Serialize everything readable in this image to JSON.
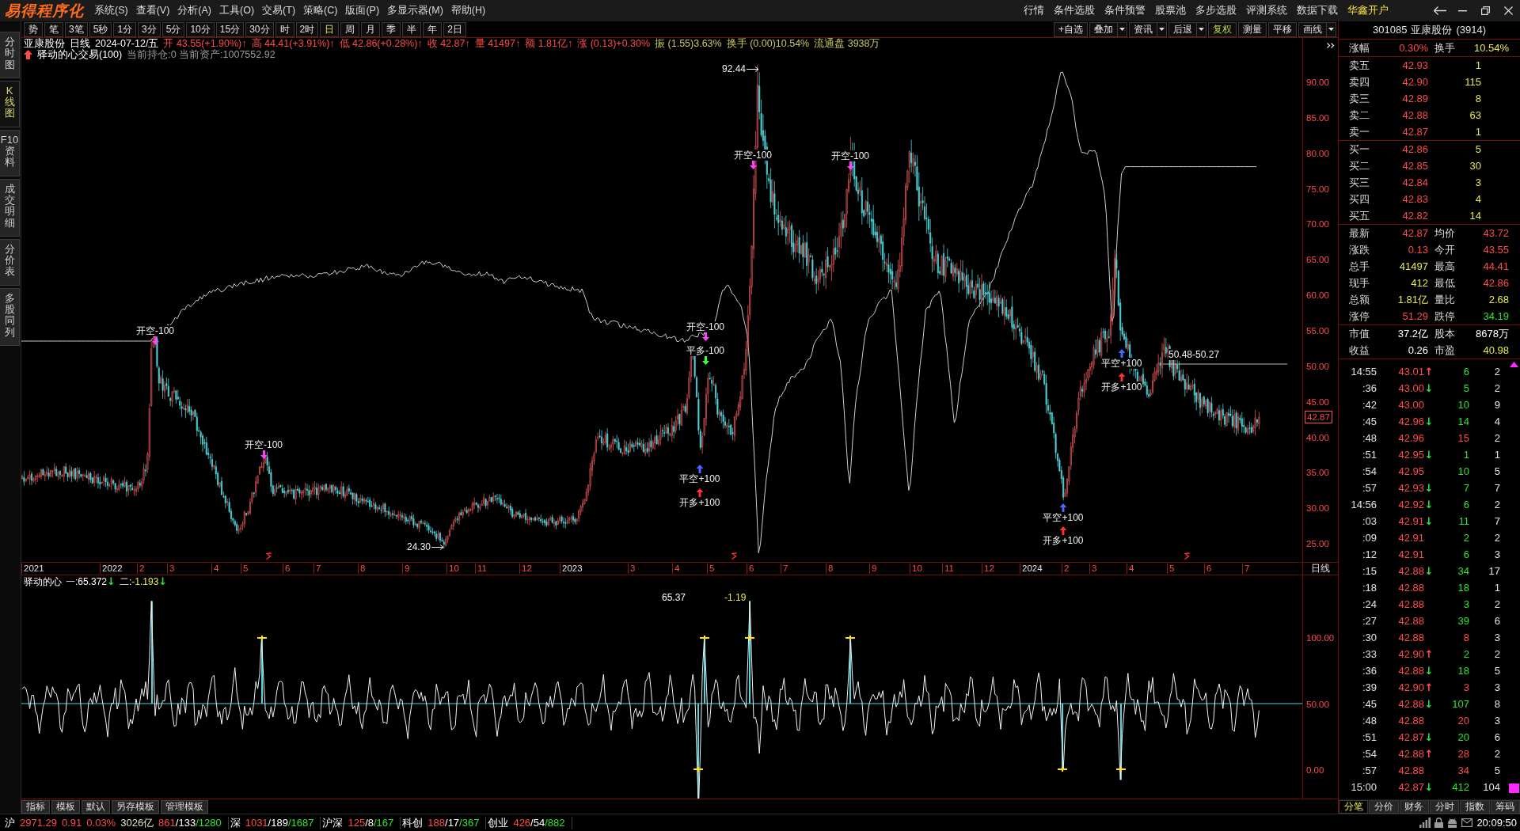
{
  "title_bar": {
    "logo": "易得程序化",
    "menu": [
      "系统(S)",
      "查看(V)",
      "分析(A)",
      "工具(O)",
      "交易(T)",
      "策略(C)",
      "版面(P)",
      "多显示器(M)",
      "帮助(H)"
    ],
    "links": [
      {
        "label": "行情",
        "highlight": false
      },
      {
        "label": "条件选股",
        "highlight": false
      },
      {
        "label": "条件预警",
        "highlight": false
      },
      {
        "label": "股票池",
        "highlight": false
      },
      {
        "label": "多步选股",
        "highlight": false
      },
      {
        "label": "评测系统",
        "highlight": false
      },
      {
        "label": "数据下载",
        "highlight": false
      },
      {
        "label": "华鑫开户",
        "highlight": true
      }
    ]
  },
  "side_tabs": [
    {
      "label": "分时图",
      "selected": false
    },
    {
      "label": "K线图",
      "selected": true
    },
    {
      "label": "F10资料",
      "selected": false
    },
    {
      "label": "成交明细",
      "selected": false
    },
    {
      "label": "分价表",
      "selected": false
    },
    {
      "label": "多股同列",
      "selected": false
    }
  ],
  "toolbar": {
    "periods": [
      {
        "label": "势",
        "selected": false
      },
      {
        "label": "笔",
        "selected": false
      },
      {
        "label": "3笔",
        "selected": false
      },
      {
        "label": "5秒",
        "selected": false
      },
      {
        "label": "1分",
        "selected": false
      },
      {
        "label": "3分",
        "selected": false
      },
      {
        "label": "5分",
        "selected": false
      },
      {
        "label": "10分",
        "selected": false
      },
      {
        "label": "15分",
        "selected": false
      },
      {
        "label": "30分",
        "selected": false
      },
      {
        "label": "时",
        "selected": false
      },
      {
        "label": "2时",
        "selected": false
      },
      {
        "label": "日",
        "selected": true
      },
      {
        "label": "周",
        "selected": false
      },
      {
        "label": "月",
        "selected": false
      },
      {
        "label": "季",
        "selected": false
      },
      {
        "label": "半",
        "selected": false
      },
      {
        "label": "年",
        "selected": false
      },
      {
        "label": "2日",
        "selected": false
      }
    ],
    "tools": [
      {
        "label": "+自选",
        "menu": false,
        "on": false
      },
      {
        "label": "叠加",
        "menu": true,
        "on": false
      },
      {
        "label": "资讯",
        "menu": true,
        "on": false
      },
      {
        "label": "后退",
        "menu": true,
        "on": false
      },
      {
        "label": "复权",
        "menu": false,
        "on": true
      },
      {
        "label": "测量",
        "menu": false,
        "on": false
      },
      {
        "label": "平移",
        "menu": false,
        "on": false
      },
      {
        "label": "画线",
        "menu": true,
        "on": false
      }
    ]
  },
  "chart": {
    "quote_line": [
      {
        "text": "亚康股份",
        "color": "#ffffff"
      },
      {
        "text": "日线",
        "color": "#ffffff"
      },
      {
        "text": "2024-07-12/五",
        "color": "#ffffff"
      },
      {
        "text": "开 43.55(+1.90%)↑",
        "color": "#ff4a4a"
      },
      {
        "text": "高 44.41(+3.91%)↑",
        "color": "#ff4a4a"
      },
      {
        "text": "低 42.86(+0.28%)↑",
        "color": "#ff4a4a"
      },
      {
        "text": "收 42.87↑",
        "color": "#ff4a4a"
      },
      {
        "text": "量 41497↑",
        "color": "#ff4a4a"
      },
      {
        "text": "额 1.81亿↑",
        "color": "#ff4a4a"
      },
      {
        "text": "涨 (0.13)+0.30%",
        "color": "#ff4a4a"
      },
      {
        "text": "振 (1.55)3.63%",
        "color": "#c8c864"
      },
      {
        "text": "换手 (0.00)10.54%",
        "color": "#c8c864"
      },
      {
        "text": "流通盘 3938万",
        "color": "#c8c864"
      }
    ],
    "strategy": {
      "name": "驿动的心交易(100)",
      "status": "当前持仓:0 当前资产:1007552.92"
    },
    "price_axis": [
      "90.00",
      "85.00",
      "80.00",
      "75.00",
      "70.00",
      "65.00",
      "60.00",
      "55.00",
      "50.00",
      "45.00",
      "40.00",
      "35.00",
      "30.00",
      "25.00"
    ],
    "last_price": "42.87",
    "extremes": [
      "92.44",
      "24.30"
    ],
    "range_label": "50.48-50.27",
    "signals": [
      {
        "label": "开空-100",
        "kind": "open_short"
      },
      {
        "label": "开空-100",
        "kind": "open_short"
      },
      {
        "label": "开空-100",
        "kind": "open_short"
      },
      {
        "label": "平多-100",
        "kind": "close_long"
      },
      {
        "label": "平空+100",
        "kind": "close_short"
      },
      {
        "label": "开多+100",
        "kind": "open_long"
      },
      {
        "label": "开空-100",
        "kind": "open_short"
      },
      {
        "label": "开空-100",
        "kind": "open_short"
      },
      {
        "label": "平空+100",
        "kind": "close_short"
      },
      {
        "label": "开多+100",
        "kind": "open_long"
      },
      {
        "label": "平空+100",
        "kind": "close_short"
      },
      {
        "label": "开多+100",
        "kind": "open_long"
      }
    ],
    "time_axis": [
      {
        "label": "2021",
        "kind": "year"
      },
      {
        "label": "2022",
        "kind": "year"
      },
      {
        "label": "2",
        "kind": "month"
      },
      {
        "label": "3",
        "kind": "month"
      },
      {
        "label": "4",
        "kind": "month"
      },
      {
        "label": "5",
        "kind": "month"
      },
      {
        "label": "6",
        "kind": "month"
      },
      {
        "label": "7",
        "kind": "month"
      },
      {
        "label": "8",
        "kind": "month"
      },
      {
        "label": "9",
        "kind": "month"
      },
      {
        "label": "10",
        "kind": "month"
      },
      {
        "label": "11",
        "kind": "month"
      },
      {
        "label": "12",
        "kind": "month"
      },
      {
        "label": "2023",
        "kind": "year"
      },
      {
        "label": "3",
        "kind": "month"
      },
      {
        "label": "4",
        "kind": "month"
      },
      {
        "label": "5",
        "kind": "month"
      },
      {
        "label": "6",
        "kind": "month"
      },
      {
        "label": "7",
        "kind": "month"
      },
      {
        "label": "8",
        "kind": "month"
      },
      {
        "label": "9",
        "kind": "month"
      },
      {
        "label": "10",
        "kind": "month"
      },
      {
        "label": "11",
        "kind": "month"
      },
      {
        "label": "12",
        "kind": "month"
      },
      {
        "label": "2024",
        "kind": "year"
      },
      {
        "label": "2",
        "kind": "month"
      },
      {
        "label": "3",
        "kind": "month"
      },
      {
        "label": "4",
        "kind": "month"
      },
      {
        "label": "5",
        "kind": "month"
      },
      {
        "label": "6",
        "kind": "month"
      },
      {
        "label": "7",
        "kind": "month"
      }
    ],
    "period_label": "日线"
  },
  "indicator": {
    "name": "驿动的心",
    "lines": [
      {
        "label": "一:",
        "value": "65.372",
        "color": "#ffffff",
        "arrow": {
          "text": "↓",
          "color": "#2ee62e"
        }
      },
      {
        "label": "二:",
        "value": "-1.193",
        "color": "#e8e84a",
        "arrow": {
          "text": "↓",
          "color": "#2ee62e"
        }
      }
    ],
    "value_labels": [
      {
        "text": "65.37",
        "color": "#ffffff"
      },
      {
        "text": "-1.19",
        "color": "#e8e84a"
      }
    ],
    "axis": [
      "100.00",
      "50.00",
      "0.00"
    ]
  },
  "template_tabs": [
    "指标",
    "模板",
    "默认",
    "另存模板",
    "管理模板"
  ],
  "quote_panel": {
    "code": "301085",
    "name": "亚康股份",
    "count": "(3914)",
    "summary": [
      {
        "label": "涨幅",
        "value": "0.30%",
        "color": "#ff4a4a"
      },
      {
        "label": "换手",
        "value": "10.54%",
        "color": "#e8e84a"
      }
    ],
    "asks": [
      {
        "label": "卖五",
        "price": "42.93",
        "volume": "1"
      },
      {
        "label": "卖四",
        "price": "42.90",
        "volume": "115"
      },
      {
        "label": "卖三",
        "price": "42.89",
        "volume": "8"
      },
      {
        "label": "卖二",
        "price": "42.88",
        "volume": "63"
      },
      {
        "label": "卖一",
        "price": "42.87",
        "volume": "1"
      }
    ],
    "bids": [
      {
        "label": "买一",
        "price": "42.86",
        "volume": "5"
      },
      {
        "label": "买二",
        "price": "42.85",
        "volume": "30"
      },
      {
        "label": "买三",
        "price": "42.84",
        "volume": "3"
      },
      {
        "label": "买四",
        "price": "42.83",
        "volume": "4"
      },
      {
        "label": "买五",
        "price": "42.82",
        "volume": "14"
      }
    ],
    "stats": [
      {
        "label": "最新",
        "value": "42.87",
        "color": "#ff4a4a"
      },
      {
        "label": "均价",
        "value": "43.72",
        "color": "#ff4a4a"
      },
      {
        "label": "涨跌",
        "value": "0.13",
        "color": "#ff4a4a"
      },
      {
        "label": "今开",
        "value": "43.55",
        "color": "#ff4a4a"
      },
      {
        "label": "总手",
        "value": "41497",
        "color": "#e8e84a"
      },
      {
        "label": "最高",
        "value": "44.41",
        "color": "#ff4a4a"
      },
      {
        "label": "现手",
        "value": "412",
        "color": "#e8e84a"
      },
      {
        "label": "最低",
        "value": "42.86",
        "color": "#ff4a4a"
      },
      {
        "label": "总额",
        "value": "1.81亿",
        "color": "#e8e84a"
      },
      {
        "label": "量比",
        "value": "2.68",
        "color": "#e8e84a"
      },
      {
        "label": "涨停",
        "value": "51.29",
        "color": "#ff4a4a"
      },
      {
        "label": "跌停",
        "value": "34.19",
        "color": "#2ee62e"
      }
    ],
    "fundamentals": [
      {
        "label": "市值",
        "value": "37.2亿",
        "color": "#ffffff"
      },
      {
        "label": "股本",
        "value": "8678万",
        "color": "#ffffff"
      },
      {
        "label": "收益",
        "value": "0.26",
        "color": "#ffffff"
      },
      {
        "label": "市盈",
        "value": "40.98",
        "color": "#e8e84a"
      }
    ],
    "ticks": [
      {
        "time": "14:55",
        "price": "43.01",
        "arrow": {
          "text": "↑",
          "color": "#ff4a4a"
        },
        "volume": "6",
        "color": "#2ee62e",
        "count": "2"
      },
      {
        "time": ":36",
        "price": "43.00",
        "arrow": {
          "text": "↓",
          "color": "#2ee62e"
        },
        "volume": "5",
        "color": "#2ee62e",
        "count": "2"
      },
      {
        "time": ":42",
        "price": "43.00",
        "volume": "10",
        "color": "#2ee62e",
        "count": "9"
      },
      {
        "time": ":45",
        "price": "42.96",
        "arrow": {
          "text": "↓",
          "color": "#2ee62e"
        },
        "volume": "14",
        "color": "#2ee62e",
        "count": "4"
      },
      {
        "time": ":48",
        "price": "42.96",
        "volume": "15",
        "color": "#ff4a4a",
        "count": "2"
      },
      {
        "time": ":51",
        "price": "42.95",
        "arrow": {
          "text": "↓",
          "color": "#2ee62e"
        },
        "volume": "1",
        "color": "#2ee62e",
        "count": "1"
      },
      {
        "time": ":54",
        "price": "42.95",
        "volume": "10",
        "color": "#2ee62e",
        "count": "5"
      },
      {
        "time": ":57",
        "price": "42.93",
        "arrow": {
          "text": "↓",
          "color": "#2ee62e"
        },
        "volume": "7",
        "color": "#2ee62e",
        "count": "7"
      },
      {
        "time": "14:56",
        "price": "42.92",
        "arrow": {
          "text": "↓",
          "color": "#2ee62e"
        },
        "volume": "6",
        "color": "#2ee62e",
        "count": "2"
      },
      {
        "time": ":03",
        "price": "42.91",
        "arrow": {
          "text": "↓",
          "color": "#2ee62e"
        },
        "volume": "11",
        "color": "#2ee62e",
        "count": "7"
      },
      {
        "time": ":09",
        "price": "42.91",
        "volume": "2",
        "color": "#2ee62e",
        "count": "2"
      },
      {
        "time": ":12",
        "price": "42.91",
        "volume": "6",
        "color": "#2ee62e",
        "count": "3"
      },
      {
        "time": ":15",
        "price": "42.88",
        "arrow": {
          "text": "↓",
          "color": "#2ee62e"
        },
        "volume": "34",
        "color": "#2ee62e",
        "count": "17"
      },
      {
        "time": ":18",
        "price": "42.88",
        "volume": "18",
        "color": "#2ee62e",
        "count": "1"
      },
      {
        "time": ":24",
        "price": "42.88",
        "volume": "3",
        "color": "#2ee62e",
        "count": "2"
      },
      {
        "time": ":27",
        "price": "42.88",
        "volume": "39",
        "color": "#2ee62e",
        "count": "6"
      },
      {
        "time": ":30",
        "price": "42.88",
        "volume": "8",
        "color": "#ff4a4a",
        "count": "3"
      },
      {
        "time": ":33",
        "price": "42.90",
        "arrow": {
          "text": "↑",
          "color": "#ff4a4a"
        },
        "volume": "2",
        "color": "#2ee62e",
        "count": "2"
      },
      {
        "time": ":36",
        "price": "42.88",
        "arrow": {
          "text": "↓",
          "color": "#2ee62e"
        },
        "volume": "18",
        "color": "#2ee62e",
        "count": "5"
      },
      {
        "time": ":39",
        "price": "42.90",
        "arrow": {
          "text": "↑",
          "color": "#ff4a4a"
        },
        "volume": "3",
        "color": "#ff4a4a",
        "count": "3"
      },
      {
        "time": ":45",
        "price": "42.88",
        "arrow": {
          "text": "↓",
          "color": "#2ee62e"
        },
        "volume": "107",
        "color": "#2ee62e",
        "count": "8"
      },
      {
        "time": ":48",
        "price": "42.88",
        "volume": "20",
        "color": "#ff4a4a",
        "count": "3"
      },
      {
        "time": ":51",
        "price": "42.87",
        "arrow": {
          "text": "↓",
          "color": "#2ee62e"
        },
        "volume": "20",
        "color": "#2ee62e",
        "count": "6"
      },
      {
        "time": ":54",
        "price": "42.88",
        "arrow": {
          "text": "↑",
          "color": "#ff4a4a"
        },
        "volume": "28",
        "color": "#ff4a4a",
        "count": "2"
      },
      {
        "time": ":57",
        "price": "42.88",
        "volume": "34",
        "color": "#ff4a4a",
        "count": "5"
      },
      {
        "time": "15:00",
        "price": "42.87",
        "arrow": {
          "text": "↓",
          "color": "#2ee62e"
        },
        "volume": "412",
        "color": "#2ee62e",
        "count": "104"
      }
    ],
    "tabs": [
      {
        "label": "分笔",
        "selected": true
      },
      {
        "label": "分价",
        "selected": false
      },
      {
        "label": "财务",
        "selected": false
      },
      {
        "label": "分时",
        "selected": false
      },
      {
        "label": "指数",
        "selected": false
      },
      {
        "label": "筹码",
        "selected": false
      }
    ]
  },
  "status_bar": {
    "markets": [
      {
        "name": "沪",
        "quote": [
          {
            "text": "2971.29",
            "color": "#ff4a4a"
          },
          {
            "text": "0.91",
            "color": "#ff4a4a"
          },
          {
            "text": "0.03%",
            "color": "#ff4a4a"
          },
          {
            "text": "3026亿",
            "color": "#e2e2c8"
          }
        ],
        "up": "861",
        "flat": "/133",
        "down": "/1280"
      },
      {
        "name": "深",
        "up": "1031",
        "flat": "/189",
        "down": "/1687"
      },
      {
        "name": "沪深",
        "up": "125",
        "flat": "/8",
        "down": "/167"
      },
      {
        "name": "科创",
        "up": "188",
        "flat": "/17",
        "down": "/367"
      },
      {
        "name": "创业",
        "up": "426",
        "flat": "/54",
        "down": "/882"
      }
    ],
    "time": "20:09:50"
  }
}
